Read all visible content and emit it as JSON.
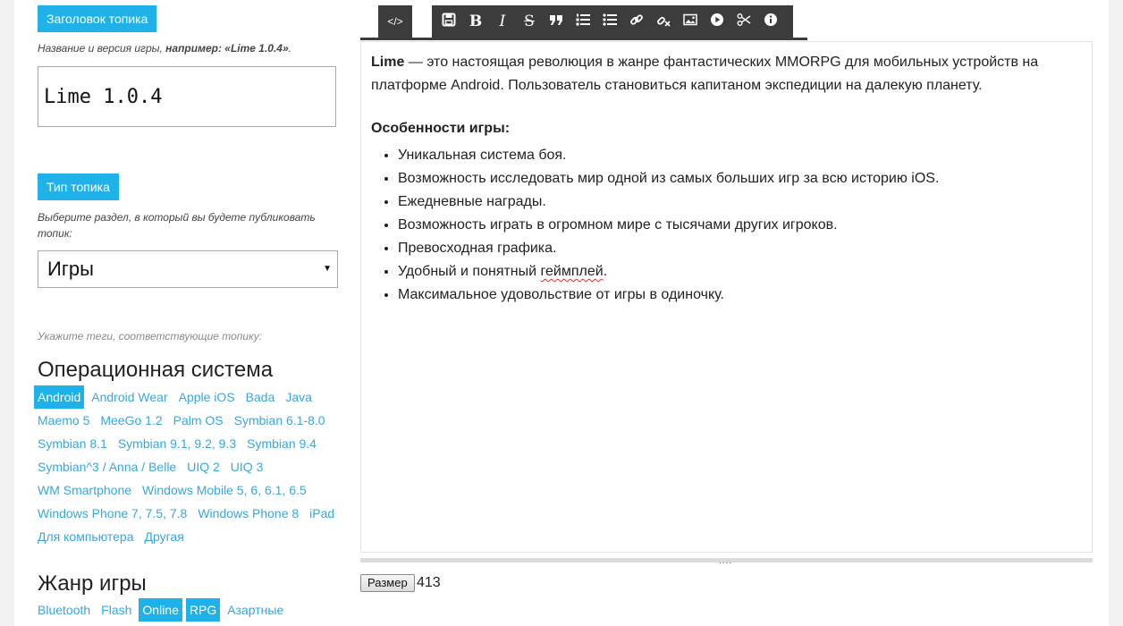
{
  "topic_title": {
    "label": "Заголовок топика",
    "hint_prefix": "Название и версия игры, ",
    "hint_bold": "например: «Lime 1.0.4»",
    "hint_suffix": ".",
    "value": "Lime 1.0.4"
  },
  "topic_type": {
    "label": "Тип топика",
    "hint": "Выберите раздел, в который вы будете публиковать топик:",
    "selected": "Игры"
  },
  "tags_hint": "Укажите теги, соответствующие топику:",
  "os_section": {
    "title": "Операционная система",
    "tags": [
      {
        "label": "Android",
        "active": true
      },
      {
        "label": "Android Wear",
        "active": false
      },
      {
        "label": "Apple iOS",
        "active": false
      },
      {
        "label": "Bada",
        "active": false
      },
      {
        "label": "Java",
        "active": false
      },
      {
        "label": "Maemo 5",
        "active": false
      },
      {
        "label": "MeeGo 1.2",
        "active": false
      },
      {
        "label": "Palm OS",
        "active": false
      },
      {
        "label": "Symbian 6.1-8.0",
        "active": false
      },
      {
        "label": "Symbian 8.1",
        "active": false
      },
      {
        "label": "Symbian 9.1, 9.2, 9.3",
        "active": false
      },
      {
        "label": "Symbian 9.4",
        "active": false
      },
      {
        "label": "Symbian^3 / Anna / Belle",
        "active": false
      },
      {
        "label": "UIQ 2",
        "active": false
      },
      {
        "label": "UIQ 3",
        "active": false
      },
      {
        "label": "WM Smartphone",
        "active": false
      },
      {
        "label": "Windows Mobile 5, 6, 6.1, 6.5",
        "active": false
      },
      {
        "label": "Windows Phone 7, 7.5, 7.8",
        "active": false
      },
      {
        "label": "Windows Phone 8",
        "active": false
      },
      {
        "label": "iPad",
        "active": false
      },
      {
        "label": "Для компьютера",
        "active": false
      },
      {
        "label": "Другая",
        "active": false
      }
    ]
  },
  "genre_section": {
    "title": "Жанр игры",
    "tags": [
      {
        "label": "Bluetooth",
        "active": false
      },
      {
        "label": "Flash",
        "active": false
      },
      {
        "label": "Online",
        "active": true
      },
      {
        "label": "RPG",
        "active": true
      },
      {
        "label": "Азартные",
        "active": false
      }
    ]
  },
  "toolbar": {
    "source_label": "</>",
    "buttons": [
      {
        "icon": "save-icon"
      },
      {
        "icon": "bold-icon",
        "glyph": "B"
      },
      {
        "icon": "italic-icon",
        "glyph": "I"
      },
      {
        "icon": "strikethrough-icon",
        "glyph": "S"
      },
      {
        "icon": "quote-icon"
      },
      {
        "icon": "ordered-list-icon"
      },
      {
        "icon": "unordered-list-icon"
      },
      {
        "icon": "link-icon"
      },
      {
        "icon": "unlink-icon"
      },
      {
        "icon": "image-icon"
      },
      {
        "icon": "video-icon"
      },
      {
        "icon": "cut-icon"
      },
      {
        "icon": "info-icon"
      }
    ]
  },
  "editor": {
    "intro_bold": "Lime",
    "intro_line1": " — это настоящая революция в жанре фантастических MMORPG для мобильных устройств на",
    "intro_line2": "платформе Android. Пользователь становиться капитаном экспедиции на далекую планету.",
    "features_title": "Особенности игры:",
    "features": [
      "Уникальная система боя.",
      "Возможность исследовать мир одной из самых больших игр за всю историю iOS.",
      "Ежедневные награды.",
      "Возможность играть в огромном мире с тысячами других игроков.",
      "Превосходная графика.",
      "Максимальное удовольствие от игры в одиночку."
    ],
    "feature_gameplay_prefix": "Удобный и понятный ",
    "feature_gameplay_word": "геймплей",
    "feature_gameplay_suffix": "."
  },
  "resize": {
    "dots": "....",
    "size_button": "Размер",
    "size_value": "413"
  },
  "colors": {
    "accent": "#1fb2e8",
    "tag_link": "#3aa6dd",
    "toolbar": "#3c3c3c"
  }
}
